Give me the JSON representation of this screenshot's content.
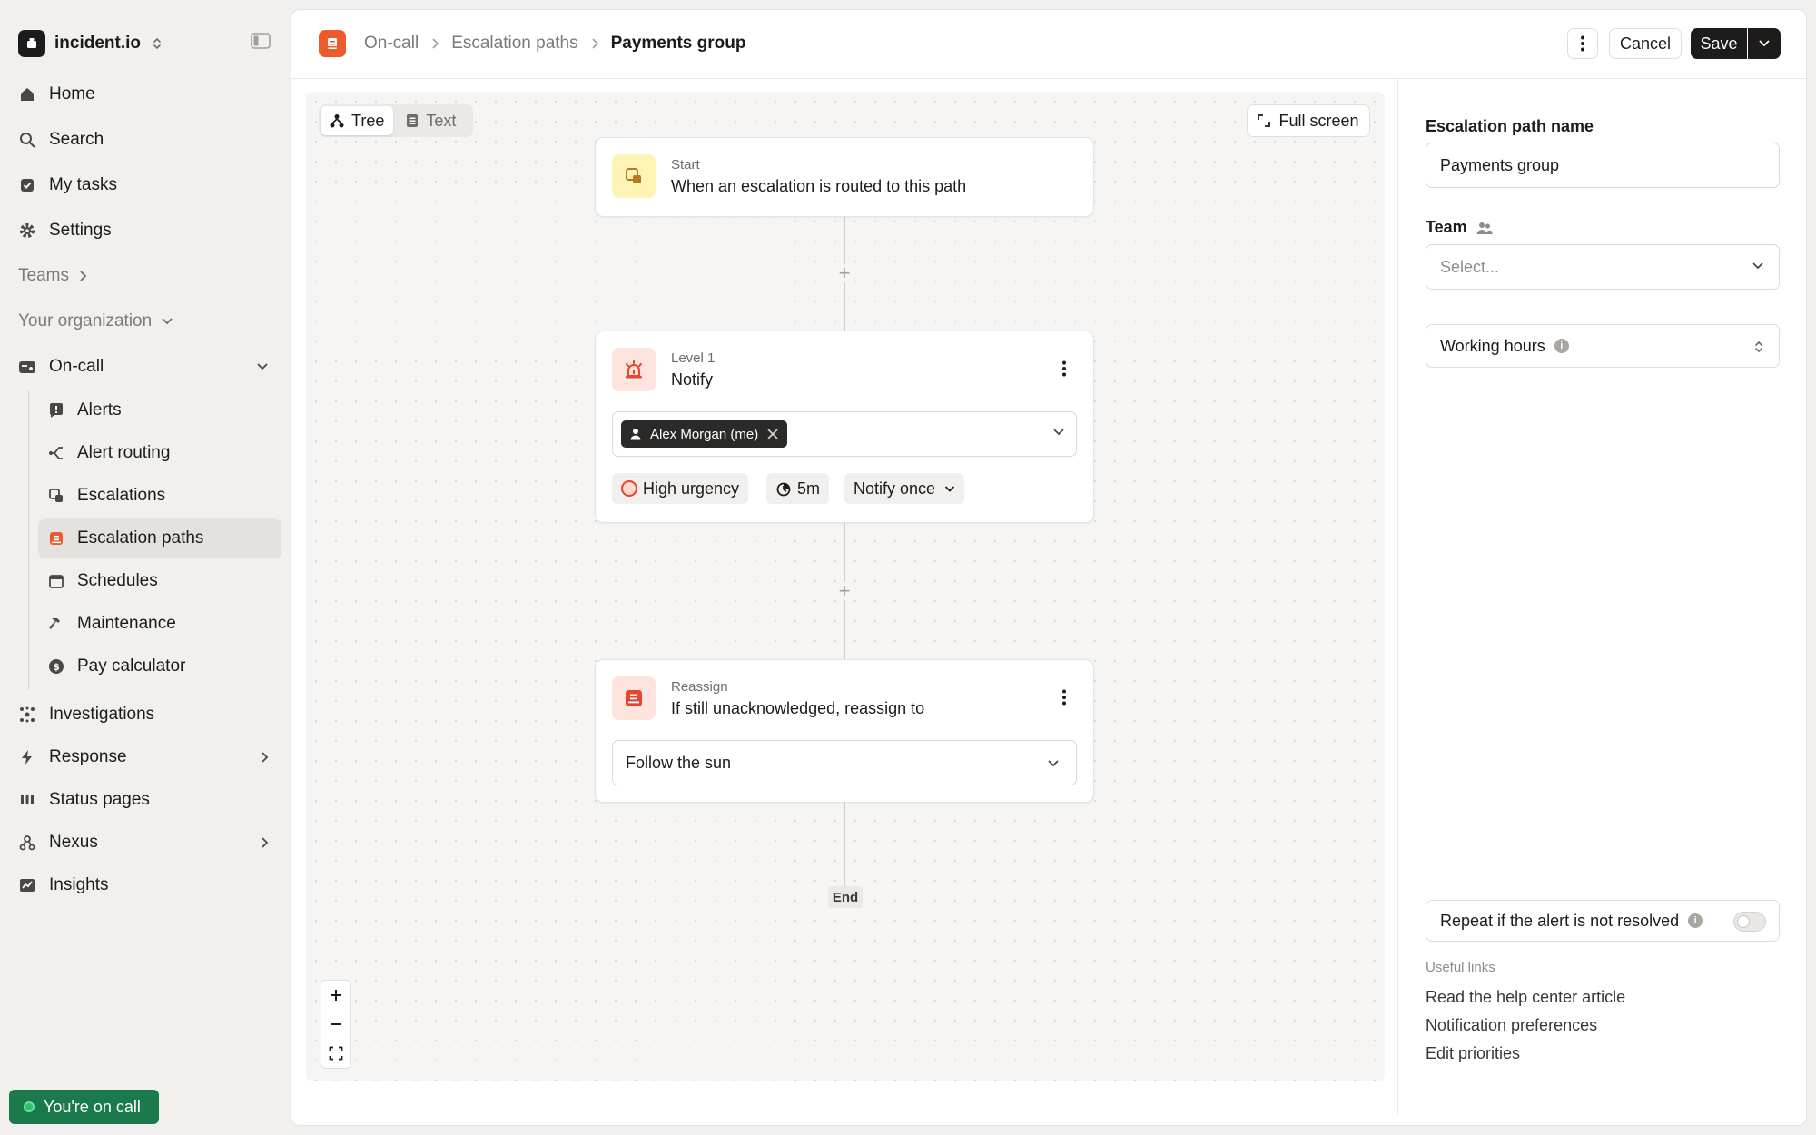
{
  "org": {
    "name": "incident.io"
  },
  "sidebar": {
    "items": [
      {
        "label": "Home",
        "icon": "home-icon"
      },
      {
        "label": "Search",
        "icon": "search-icon"
      },
      {
        "label": "My tasks",
        "icon": "tasks-icon"
      },
      {
        "label": "Settings",
        "icon": "gear-icon"
      }
    ],
    "teams_label": "Teams",
    "org_label": "Your organization",
    "oncall": {
      "label": "On-call",
      "children": [
        {
          "label": "Alerts",
          "icon": "alert-icon"
        },
        {
          "label": "Alert routing",
          "icon": "routing-icon"
        },
        {
          "label": "Escalations",
          "icon": "escalation-icon"
        },
        {
          "label": "Escalation paths",
          "icon": "escalation-path-icon",
          "active": true
        },
        {
          "label": "Schedules",
          "icon": "calendar-icon"
        },
        {
          "label": "Maintenance",
          "icon": "hammer-icon"
        },
        {
          "label": "Pay calculator",
          "icon": "dollar-icon"
        }
      ]
    },
    "after": [
      {
        "label": "Investigations",
        "icon": "investigations-icon"
      },
      {
        "label": "Response",
        "icon": "lightning-icon"
      },
      {
        "label": "Status pages",
        "icon": "status-bars-icon"
      },
      {
        "label": "Nexus",
        "icon": "nexus-icon"
      },
      {
        "label": "Insights",
        "icon": "insights-icon"
      }
    ],
    "oncall_status": "You're on call"
  },
  "breadcrumb": {
    "items": [
      "On-call",
      "Escalation paths"
    ],
    "current": "Payments group"
  },
  "actions": {
    "cancel": "Cancel",
    "save": "Save"
  },
  "canvas": {
    "views": [
      "Tree",
      "Text"
    ],
    "active_view": "Tree",
    "fullscreen": "Full screen",
    "start": {
      "kicker": "Start",
      "title": "When an escalation is routed to this path"
    },
    "level": {
      "kicker": "Level 1",
      "title": "Notify",
      "recipient": "Alex Morgan (me)",
      "urgency": "High urgency",
      "delay": "5m",
      "notify_mode": "Notify once"
    },
    "reassign": {
      "kicker": "Reassign",
      "title": "If still unacknowledged, reassign to",
      "target": "Follow the sun"
    },
    "end": "End"
  },
  "panel": {
    "name_label": "Escalation path name",
    "name_value": "Payments group",
    "team_label": "Team",
    "team_placeholder": "Select...",
    "working_hours": "Working hours",
    "repeat_label": "Repeat if the alert is not resolved",
    "repeat_enabled": false,
    "useful_links_label": "Useful links",
    "links": [
      "Read the help center article",
      "Notification preferences",
      "Edit priorities"
    ]
  },
  "colors": {
    "brand": "#ef5a2c",
    "oncall": "#1b7a4b",
    "urgency": "#e8452c"
  }
}
